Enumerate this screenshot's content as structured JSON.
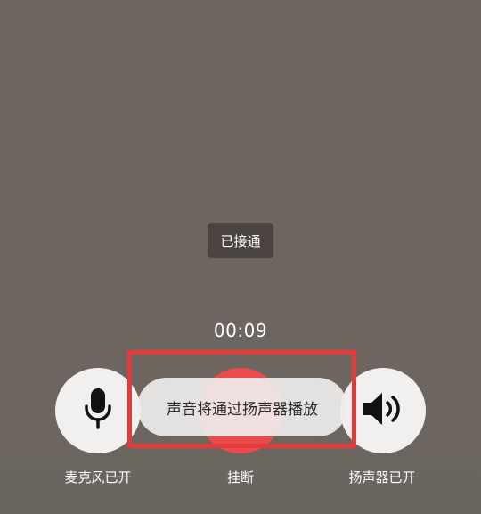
{
  "call": {
    "status": "已接通",
    "timer": "00:09"
  },
  "controls": {
    "microphone_label": "麦克风已开",
    "hangup_label": "挂断",
    "speaker_label": "扬声器已开"
  },
  "toast": {
    "text": "声音将通过扬声器播放"
  },
  "icons": {
    "microphone": "microphone-icon",
    "speaker": "speaker-icon"
  },
  "colors": {
    "background": "#6e6661",
    "status_chip": "#4a4340",
    "button_bg": "#f2f0ef",
    "hangup": "#ec4b4b",
    "highlight": "#e53a3a"
  }
}
